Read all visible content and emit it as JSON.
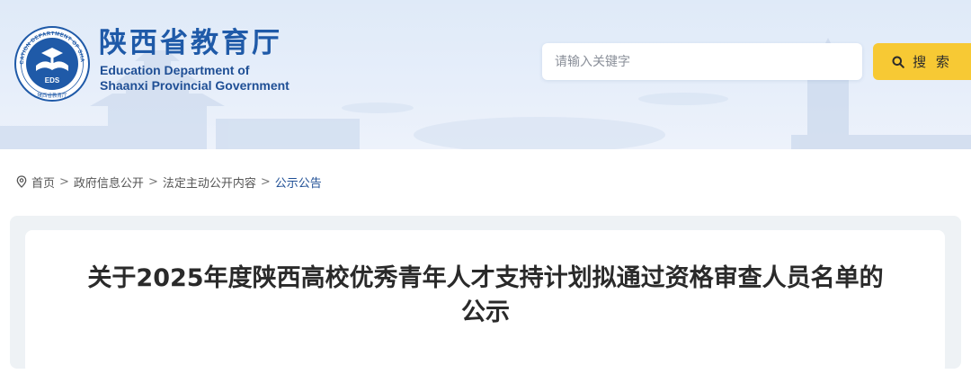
{
  "header": {
    "emblem_text": "EDS",
    "emblem_ring_text": "EDUCATION DEPARTMENT OF SHAANXI",
    "emblem_bottom_text": "陕西省教育厅",
    "site_name_zh": "陕西省教育厅",
    "site_name_en_line1": "Education Department of",
    "site_name_en_line2": "Shaanxi Provincial Government"
  },
  "search": {
    "placeholder": "请输入关键字",
    "value": "",
    "button_label": "搜 索",
    "button_color": "#f7c934"
  },
  "breadcrumb": {
    "icon": "location-pin-icon",
    "items": [
      "首页",
      "政府信息公开",
      "法定主动公开内容",
      "公示公告"
    ],
    "separator": ">"
  },
  "article": {
    "title": "关于2025年度陕西高校优秀青年人才支持计划拟通过资格审查人员名单的公示"
  },
  "colors": {
    "brand_blue": "#1f5aa8",
    "header_bg": "#e3ecf9",
    "current_crumb": "#1f4f95"
  }
}
